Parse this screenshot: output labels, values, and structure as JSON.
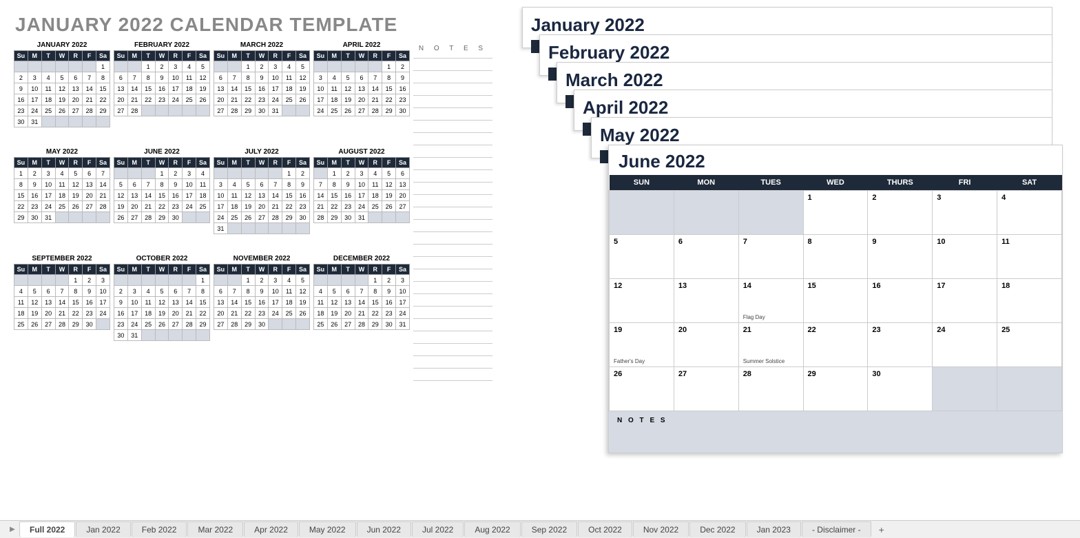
{
  "title": "JANUARY 2022 CALENDAR TEMPLATE",
  "notes_label": "N O T E S",
  "big_notes_label": "N O T E S",
  "day_headers_short": [
    "Su",
    "M",
    "T",
    "W",
    "R",
    "F",
    "Sa"
  ],
  "day_headers_long": [
    "SUN",
    "MON",
    "TUES",
    "WED",
    "THURS",
    "FRI",
    "SAT"
  ],
  "months": [
    {
      "name": "JANUARY 2022",
      "start": 6,
      "days": 31
    },
    {
      "name": "FEBRUARY 2022",
      "start": 2,
      "days": 28
    },
    {
      "name": "MARCH 2022",
      "start": 2,
      "days": 31
    },
    {
      "name": "APRIL 2022",
      "start": 5,
      "days": 30
    },
    {
      "name": "MAY 2022",
      "start": 0,
      "days": 31
    },
    {
      "name": "JUNE 2022",
      "start": 3,
      "days": 30
    },
    {
      "name": "JULY 2022",
      "start": 5,
      "days": 31
    },
    {
      "name": "AUGUST 2022",
      "start": 1,
      "days": 31
    },
    {
      "name": "SEPTEMBER 2022",
      "start": 4,
      "days": 30
    },
    {
      "name": "OCTOBER 2022",
      "start": 6,
      "days": 31
    },
    {
      "name": "NOVEMBER 2022",
      "start": 2,
      "days": 30
    },
    {
      "name": "DECEMBER 2022",
      "start": 4,
      "days": 31
    }
  ],
  "stack_cards": [
    {
      "title": "January 2022"
    },
    {
      "title": "February 2022"
    },
    {
      "title": "March 2022"
    },
    {
      "title": "April 2022"
    },
    {
      "title": "May 2022"
    }
  ],
  "big_month": {
    "title": "June 2022",
    "start": 3,
    "days": 30,
    "events": {
      "14": "Flag Day",
      "19": "Father's Day",
      "21": "Summer Solstice"
    }
  },
  "tabs": [
    "Full 2022",
    "Jan 2022",
    "Feb 2022",
    "Mar 2022",
    "Apr 2022",
    "May 2022",
    "Jun 2022",
    "Jul 2022",
    "Aug 2022",
    "Sep 2022",
    "Oct 2022",
    "Nov 2022",
    "Dec 2022",
    "Jan 2023",
    "- Disclaimer -"
  ],
  "active_tab": 0
}
